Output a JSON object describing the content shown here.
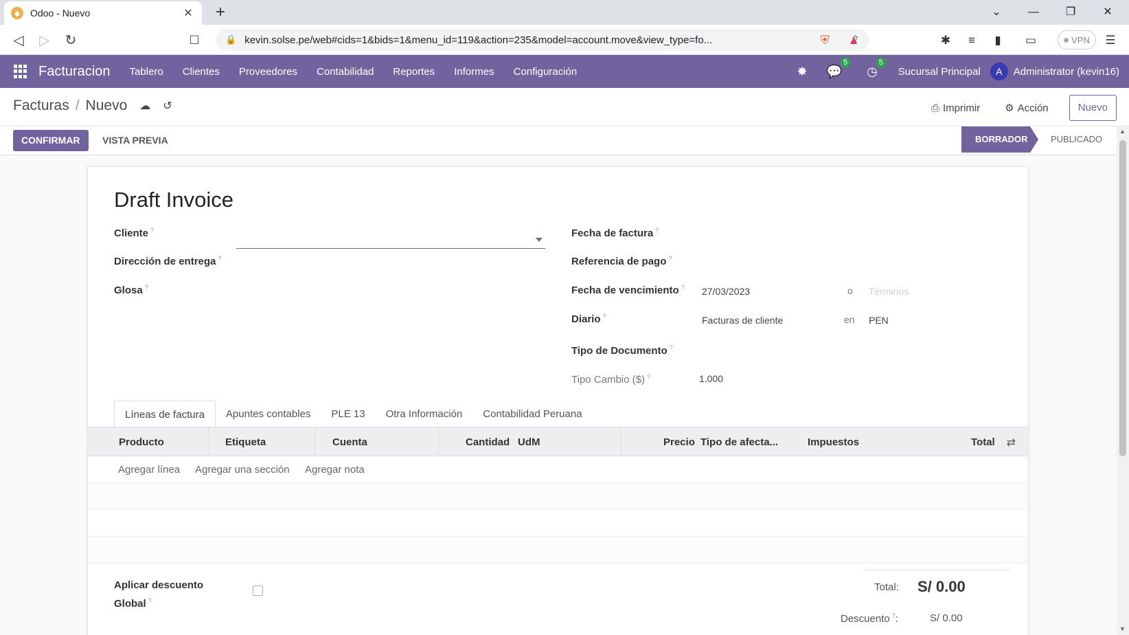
{
  "browser": {
    "tab_title": "Odoo - Nuevo",
    "tab_close": "✕",
    "new_tab": "+",
    "url": "kevin.solse.pe/web#cids=1&bids=1&menu_id=119&action=235&model=account.move&view_type=fo...",
    "vpn_label": "VPN"
  },
  "navbar": {
    "app_name": "Facturacion",
    "menu": [
      "Tablero",
      "Clientes",
      "Proveedores",
      "Contabilidad",
      "Reportes",
      "Informes",
      "Configuración"
    ],
    "messages_badge": "5",
    "activities_badge": "5",
    "branch": "Sucursal Principal",
    "avatar_letter": "A",
    "user": "Administrator (kevin16)"
  },
  "control_panel": {
    "breadcrumb_parent": "Facturas",
    "breadcrumb_sep": "/",
    "breadcrumb_current": "Nuevo",
    "print_label": "Imprimir",
    "action_label": "Acción",
    "new_label": "Nuevo"
  },
  "statusbar": {
    "confirm_label": "CONFIRMAR",
    "preview_label": "VISTA PREVIA",
    "stage_active": "BORRADOR",
    "stage_next": "PUBLICADO"
  },
  "form": {
    "title": "Draft Invoice",
    "left_labels": {
      "cliente": "Cliente",
      "direccion": "Dirección de entrega",
      "glosa": "Glosa"
    },
    "right_labels": {
      "fecha_factura": "Fecha de factura",
      "referencia_pago": "Referencia de pago",
      "fecha_vencimiento": "Fecha de vencimiento",
      "diario": "Diario",
      "tipo_documento": "Tipo de Documento",
      "tipo_cambio": "Tipo Cambio ($)"
    },
    "fecha_vencimiento_value": "27/03/2023",
    "or_word": "o",
    "terminos_placeholder": "Términos",
    "diario_value": "Facturas de cliente",
    "en_word": "en",
    "currency": "PEN",
    "tipo_cambio_value": "1.000",
    "help_mark": "?"
  },
  "tabs": [
    "Líneas de factura",
    "Apuntes contables",
    "PLE 13",
    "Otra Información",
    "Contabilidad Peruana"
  ],
  "table": {
    "headers": [
      "Producto",
      "Etiqueta",
      "Cuenta",
      "Cantidad",
      "UdM",
      "Precio",
      "Tipo de afecta...",
      "Impuestos",
      "Total"
    ],
    "add_line": "Agregar línea",
    "add_section": "Agregar una sección",
    "add_note": "Agregar nota"
  },
  "footer": {
    "discount_label_1": "Aplicar descuento",
    "discount_label_2": "Global",
    "total_label": "Total:",
    "total_value": "S/ 0.00",
    "discount_label": "Descuento",
    "discount_colon": ":",
    "discount_value": "S/ 0.00"
  }
}
